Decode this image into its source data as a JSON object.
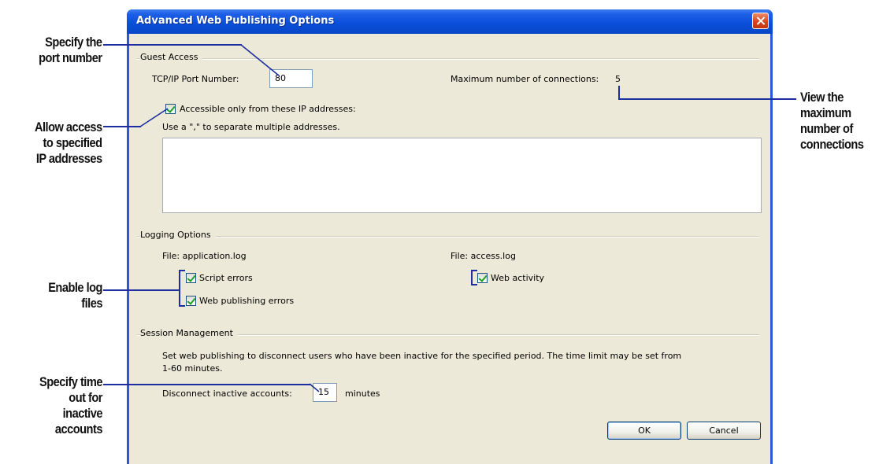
{
  "dialog": {
    "title": "Advanced Web Publishing Options"
  },
  "guest_access": {
    "group_label": "Guest Access",
    "port_label": "TCP/IP Port Number:",
    "port_value": "80",
    "max_connections_label": "Maximum number of connections:",
    "max_connections_value": "5",
    "ip_checkbox_label": "Accessible only from these IP addresses:",
    "ip_checkbox_checked": true,
    "ip_hint": "Use a \",\" to separate multiple addresses.",
    "ip_list_value": ""
  },
  "logging": {
    "group_label": "Logging Options",
    "app_log_label": "File: application.log",
    "access_log_label": "File: access.log",
    "script_errors_label": "Script errors",
    "script_errors_checked": true,
    "web_publishing_errors_label": "Web publishing errors",
    "web_publishing_errors_checked": true,
    "web_activity_label": "Web activity",
    "web_activity_checked": true
  },
  "session": {
    "group_label": "Session Management",
    "description_line1": "Set web publishing to disconnect users who have been inactive for the specified period.  The time limit may be set from",
    "description_line2": "1-60 minutes.",
    "disconnect_label": "Disconnect inactive accounts:",
    "disconnect_value": "15",
    "minutes_label": "minutes"
  },
  "buttons": {
    "ok": "OK",
    "cancel": "Cancel"
  },
  "callouts": {
    "port": [
      "Specify the",
      "port number"
    ],
    "ip": [
      "Allow access",
      "to specified",
      "IP addresses"
    ],
    "log": [
      "Enable log",
      "files"
    ],
    "timeout": [
      "Specify time",
      "out for",
      "inactive",
      "accounts"
    ],
    "max_conn": [
      "View the",
      "maximum",
      "number of",
      "connections"
    ]
  },
  "colors": {
    "title_bar": "#0a4fd9",
    "dialog_face": "#ece9d8",
    "callout_line": "#1c2ea0",
    "check_mark": "#21a121"
  }
}
